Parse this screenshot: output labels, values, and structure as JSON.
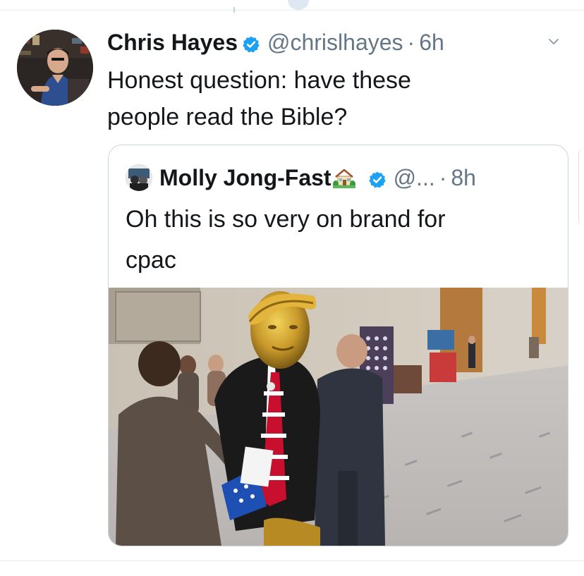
{
  "tweet": {
    "display_name": "Chris Hayes",
    "handle": "@chrislhayes",
    "separator": "·",
    "timestamp": "6h",
    "text_line1": "Honest question: have these",
    "text_line2": "people read the Bible?",
    "avatar_icon": "profile-photo",
    "verified_icon": "verified-badge-icon",
    "menu_icon": "chevron-down-icon"
  },
  "quote": {
    "display_name": "Molly Jong-Fast",
    "name_emoji_icon": "house-with-garden-icon",
    "handle": "@...",
    "separator": "·",
    "timestamp": "8h",
    "text_line1": "Oh this is so very on brand for",
    "text_line2": "cpac",
    "media_icon": "photo-golden-statue-convention-hall"
  },
  "colors": {
    "text_primary": "#14171a",
    "text_secondary": "#657786",
    "verified_blue": "#1da1f2",
    "border": "#ccd6dd"
  }
}
